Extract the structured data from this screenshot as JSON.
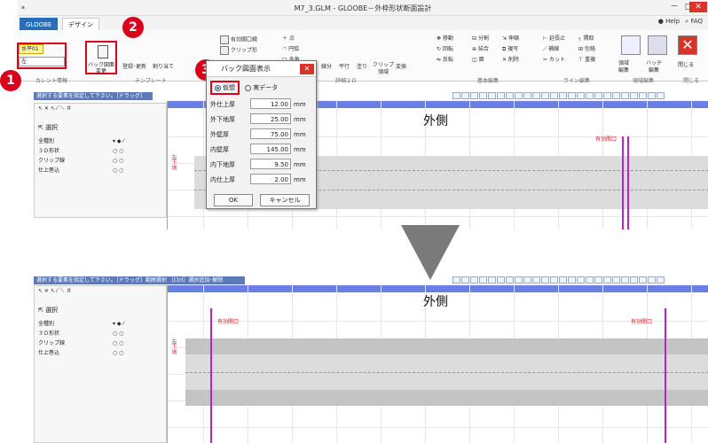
{
  "window": {
    "title": "M7_3.GLM - GLOOBE－外枠形状断面設計",
    "app_icon": "app-icon",
    "minimize": "－",
    "maximize": "□",
    "close": "✕"
  },
  "tabs": {
    "items": [
      "GLOOBE",
      "デザイン"
    ],
    "help": "Help",
    "faq": "FAQ"
  },
  "ribbon": {
    "level_select": "水平01",
    "direction_select": "左",
    "bg_button": "バック図面\n変更",
    "register_update": "登録･更新",
    "assign": "割り当て",
    "groups": {
      "current": "カレント情報",
      "template": "テンプレート",
      "detail2d": "詳細２Ｄ",
      "basic_edit": "基本編集",
      "line_edit": "ライン編集",
      "area_edit": "領域編集",
      "close": "閉じる"
    },
    "items": {
      "point": "点",
      "arc": "円弧",
      "polygon": "多角",
      "segment": "線分",
      "parallel": "平行",
      "fill": "塗り",
      "clip": "クリップ\n領域",
      "convert": "変換",
      "move": "移動",
      "split": "分割",
      "stretch": "伸縮",
      "rotate": "回転",
      "merge": "結合",
      "copy": "複写",
      "invert": "反転",
      "face": "面",
      "delete": "削除",
      "extend": "延長止",
      "trim": "補線",
      "cut": "カット",
      "overlap": "重複",
      "corner": "隅取",
      "wrap": "包絡",
      "area": "領域\n編集",
      "hatch": "ハッチ\n編集",
      "close_btn": "閉じる",
      "aperture": "有効開口線",
      "clip_ex": "クリップ形"
    }
  },
  "status": {
    "prompt_top": "選択する要素を指定して下さい。［ドラッグ］範囲選択",
    "prompt_bottom": "選択する要素を指定して下さい。［ドラッグ］範囲選択 ［Ctrl］選択追加･解除"
  },
  "left_panel": {
    "select_label": "選択",
    "filter": "全種別",
    "rows": [
      "３Ｄ形状",
      "クリップ線",
      "仕上巻込"
    ],
    "marks": "○ ○"
  },
  "canvas": {
    "label_outside": "外側",
    "aperture_label": "有効開口",
    "side_label": "左下地"
  },
  "dialog": {
    "title": "バック図面表示",
    "radio_virtual": "仮想",
    "radio_real": "実データ",
    "fields": [
      {
        "label": "外仕上厚",
        "value": "12.00",
        "unit": "mm"
      },
      {
        "label": "外下地厚",
        "value": "25.00",
        "unit": "mm"
      },
      {
        "label": "外壁厚",
        "value": "75.00",
        "unit": "mm"
      },
      {
        "label": "内壁厚",
        "value": "145.00",
        "unit": "mm"
      },
      {
        "label": "内下地厚",
        "value": "9.50",
        "unit": "mm"
      },
      {
        "label": "内仕上厚",
        "value": "2.00",
        "unit": "mm"
      }
    ],
    "ok": "OK",
    "cancel": "キャンセル"
  },
  "badges": [
    "1",
    "2",
    "3"
  ],
  "colors": {
    "accent_red": "#d9001b",
    "tab_blue": "#2b6cb7",
    "status_blue": "#5a7bb8",
    "canvas_bar": "#6a7fe0",
    "arrow_gray": "#7a7a7a"
  }
}
